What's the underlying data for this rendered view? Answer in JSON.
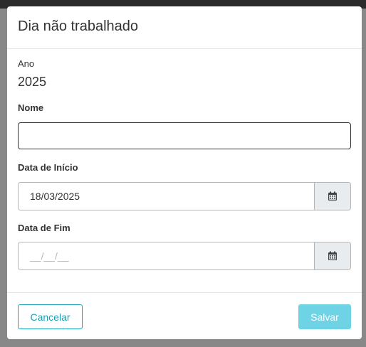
{
  "modal": {
    "title": "Dia não trabalhado"
  },
  "fields": {
    "year": {
      "label": "Ano",
      "value": "2025"
    },
    "name": {
      "label": "Nome",
      "value": ""
    },
    "start_date": {
      "label": "Data de Início",
      "value": "18/03/2025"
    },
    "end_date": {
      "label": "Data de Fim",
      "placeholder": "__/__/__"
    }
  },
  "footer": {
    "cancel_label": "Cancelar",
    "save_label": "Salvar"
  },
  "colors": {
    "accent": "#17a2b8",
    "save_button_disabled": "#6ed3e4",
    "addon_background": "#e9ecef"
  },
  "icons": {
    "date_picker": "calendar-icon"
  }
}
